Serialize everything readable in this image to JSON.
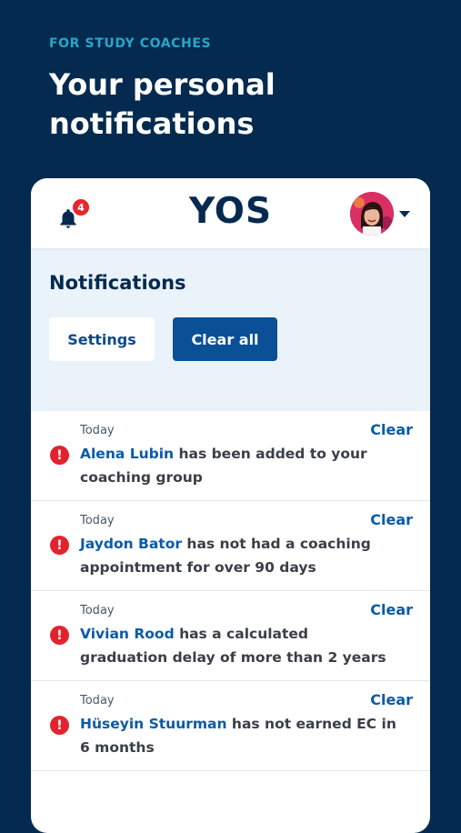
{
  "promo": {
    "eyebrow": "FOR STUDY COACHES",
    "headline": "Your personal notifications"
  },
  "appbar": {
    "logo": "YOS",
    "bell_badge_count": "4",
    "bell_icon": "bell-icon",
    "avatar_icon": "user-avatar",
    "dropdown_icon": "caret-down-icon"
  },
  "notifications": {
    "title": "Notifications",
    "settings_label": "Settings",
    "clear_all_label": "Clear all",
    "items": [
      {
        "date": "Today",
        "clear": "Clear",
        "name": "Alena Lubin",
        "text": " has been added to your coaching group"
      },
      {
        "date": "Today",
        "clear": "Clear",
        "name": "Jaydon Bator",
        "text": " has not had a coaching appointment for over 90 days"
      },
      {
        "date": "Today",
        "clear": "Clear",
        "name": "Vivian Rood",
        "text": " has a calculated graduation delay of more than 2 years"
      },
      {
        "date": "Today",
        "clear": "Clear",
        "name": "Hüseyin Stuurman",
        "text": " has not earned EC in 6 months"
      }
    ]
  },
  "colors": {
    "background": "#052a4f",
    "accent": "#27a7c8",
    "primary_button": "#0b4f96",
    "alert": "#e2232d",
    "link": "#0b5aa8"
  }
}
